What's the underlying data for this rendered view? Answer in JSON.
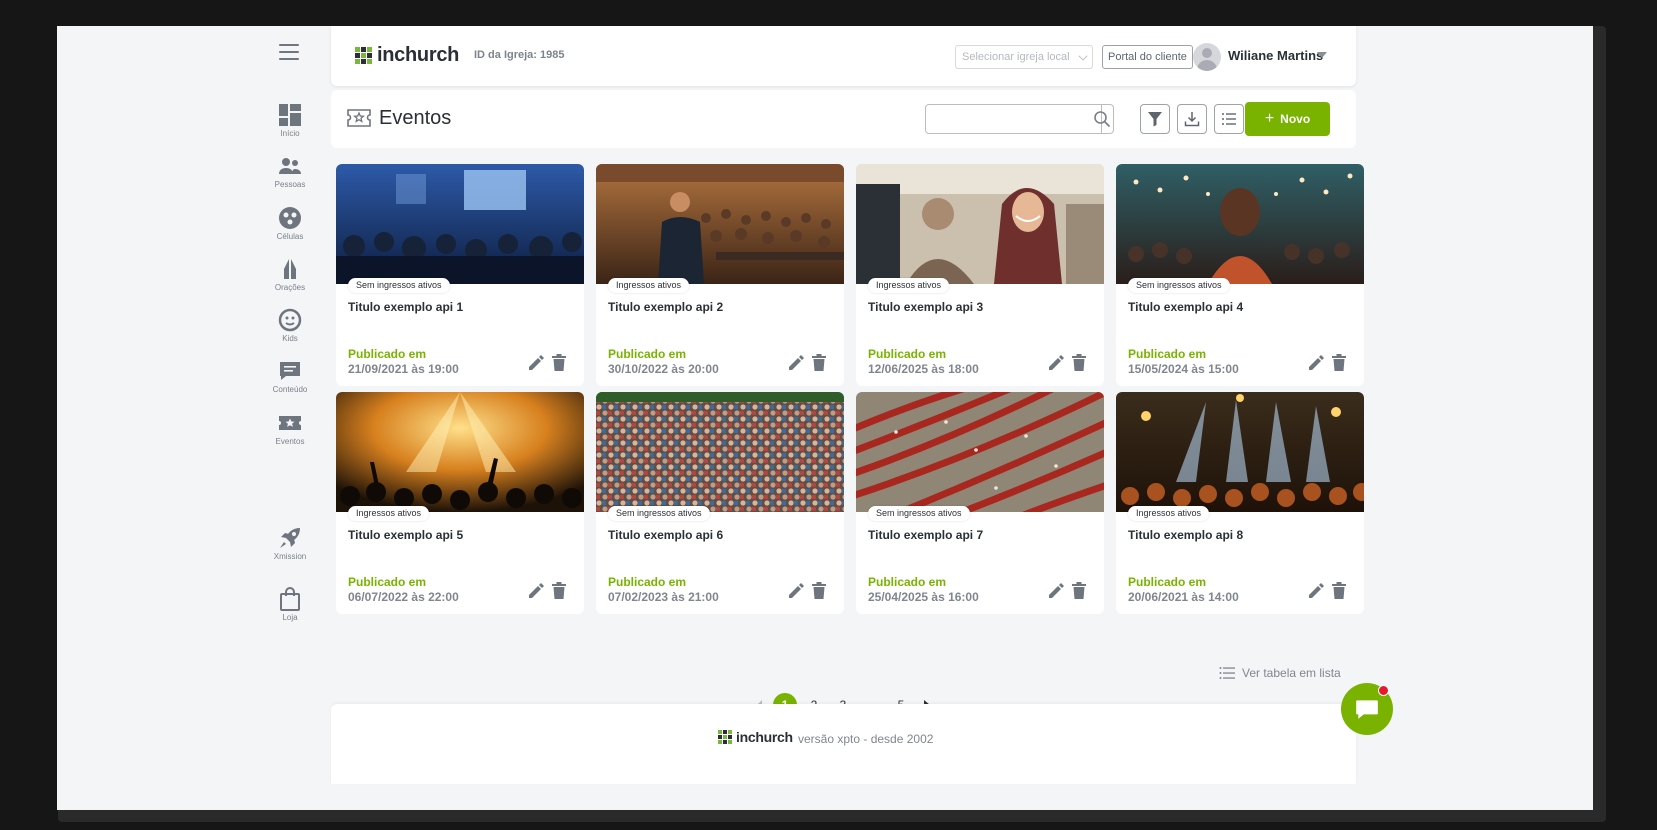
{
  "sidebar": {
    "items": [
      {
        "label": "Início",
        "icon": "dashboard-icon"
      },
      {
        "label": "Pessoas",
        "icon": "people-icon"
      },
      {
        "label": "Células",
        "icon": "cells-icon"
      },
      {
        "label": "Orações",
        "icon": "prayer-hands-icon"
      },
      {
        "label": "Kids",
        "icon": "smile-face-icon"
      },
      {
        "label": "Conteúdo",
        "icon": "chat-bubble-icon"
      },
      {
        "label": "Eventos",
        "icon": "ticket-star-icon"
      },
      {
        "label": "Xmission",
        "icon": "rocket-icon"
      },
      {
        "label": "Loja",
        "icon": "shopping-bag-icon"
      }
    ]
  },
  "header": {
    "logo_text": "inchurch",
    "church_id": "ID da Igreja: 1985",
    "church_select_placeholder": "Selecionar igreja local",
    "portal_label": "Portal do cliente",
    "user_name": "Wiliane Martins"
  },
  "page": {
    "title": "Eventos",
    "search_placeholder": "",
    "new_label": "Novo"
  },
  "events": [
    {
      "badge": "Sem ingressos ativos",
      "title": "Titulo exemplo api 1",
      "published_label": "Publicado em",
      "date": "21/09/2021 às 19:00",
      "image": "conference-audience"
    },
    {
      "badge": "Ingressos ativos",
      "title": "Titulo exemplo api 2",
      "published_label": "Publicado em",
      "date": "30/10/2022 às 20:00",
      "image": "speaker-seminar"
    },
    {
      "badge": "Ingressos ativos",
      "title": "Titulo exemplo api 3",
      "published_label": "Publicado em",
      "date": "12/06/2025 às 18:00",
      "image": "smiling-woman"
    },
    {
      "badge": "Sem ingressos ativos",
      "title": "Titulo exemplo api 4",
      "published_label": "Publicado em",
      "date": "15/05/2024 às 15:00",
      "image": "crowd-hall"
    },
    {
      "badge": "Ingressos ativos",
      "title": "Titulo exemplo api 5",
      "published_label": "Publicado em",
      "date": "06/07/2022 às 22:00",
      "image": "concert-lights"
    },
    {
      "badge": "Sem ingressos ativos",
      "title": "Titulo exemplo api 6",
      "published_label": "Publicado em",
      "date": "07/02/2023 às 21:00",
      "image": "dense-crowd"
    },
    {
      "badge": "Sem ingressos ativos",
      "title": "Titulo exemplo api 7",
      "published_label": "Publicado em",
      "date": "25/04/2025 às 16:00",
      "image": "auditorium-seats"
    },
    {
      "badge": "Ingressos ativos",
      "title": "Titulo exemplo api 8",
      "published_label": "Publicado em",
      "date": "20/06/2021 às 14:00",
      "image": "stage-show"
    }
  ],
  "pagination": {
    "pages": [
      "1",
      "2",
      "3",
      "...",
      "5"
    ],
    "current": "1",
    "list_view_label": "Ver tabela em lista"
  },
  "footer": {
    "logo_text": "inchurch",
    "version": "versão xpto - desde 2002"
  },
  "colors": {
    "accent": "#79b300",
    "notification": "#e8192c"
  }
}
